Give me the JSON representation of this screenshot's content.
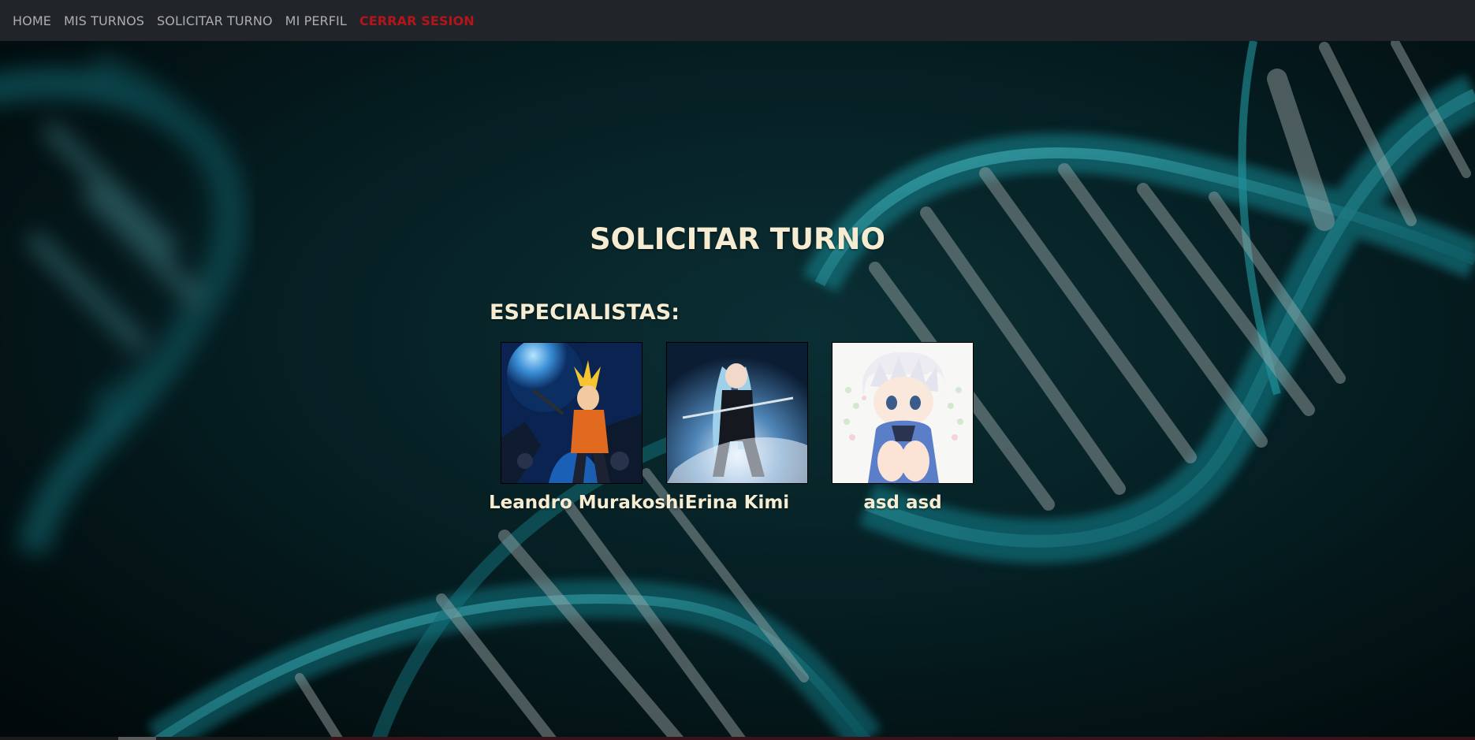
{
  "nav": {
    "items": [
      {
        "label": "HOME"
      },
      {
        "label": "MIS TURNOS"
      },
      {
        "label": "SOLICITAR TURNO"
      },
      {
        "label": "MI PERFIL"
      }
    ],
    "logout_label": "CERRAR SESION"
  },
  "page": {
    "title": "SOLICITAR TURNO",
    "section_title": "ESPECIALISTAS:"
  },
  "specialists": [
    {
      "name": "Leandro Murakoshi",
      "photo": "anime-ninja-portrait"
    },
    {
      "name": "Erina Kimi",
      "photo": "anime-swordswoman-portrait"
    },
    {
      "name": "asd asd",
      "photo": "anime-white-hair-boy-portrait"
    }
  ],
  "colors": {
    "navbar_bg": "#212529",
    "nav_link": "#a8aaad",
    "logout": "#b3151b",
    "heading_text": "#f5ecd2",
    "background": "#041214",
    "dna_teal": "#1aa7b5"
  }
}
